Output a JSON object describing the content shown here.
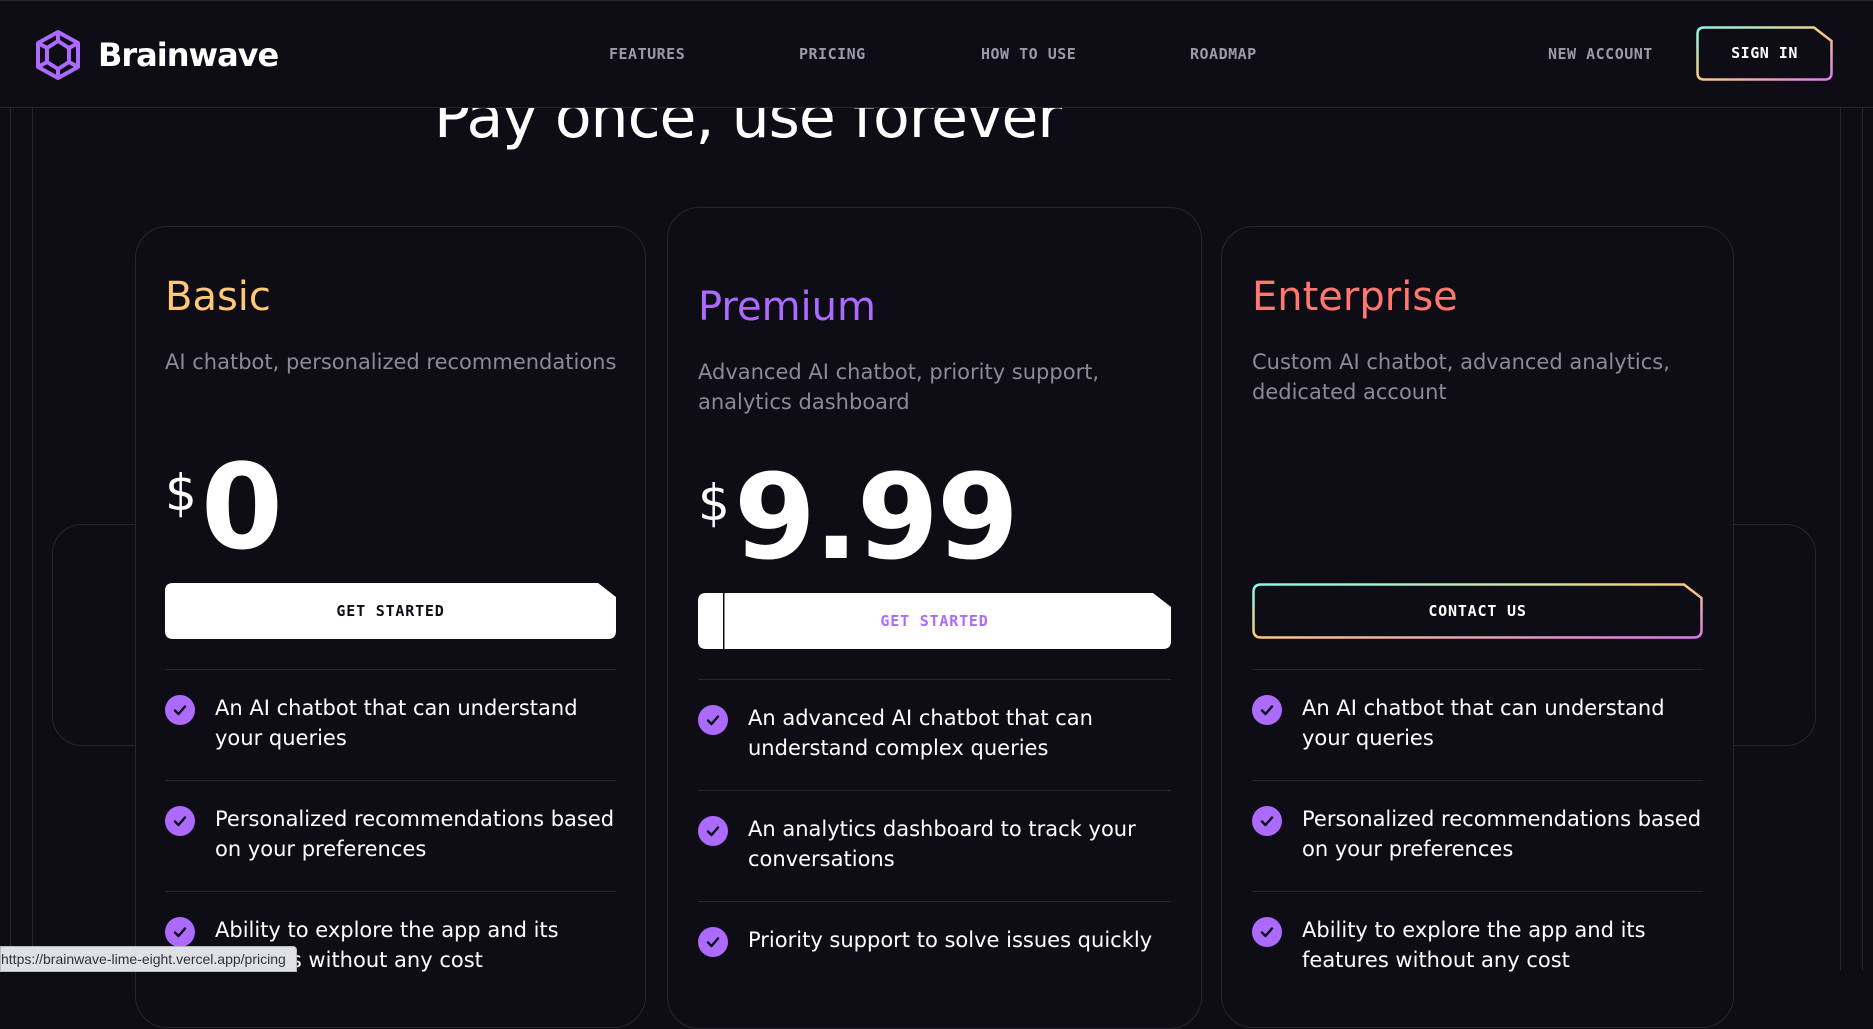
{
  "brand": {
    "name": "Brainwave"
  },
  "nav": {
    "items": [
      {
        "label": "FEATURES"
      },
      {
        "label": "PRICING"
      },
      {
        "label": "HOW TO USE"
      },
      {
        "label": "ROADMAP"
      }
    ],
    "new_account": "NEW ACCOUNT",
    "sign_in": "SIGN IN"
  },
  "hero": {
    "title": "Pay once, use forever"
  },
  "plans": [
    {
      "title": "Basic",
      "title_color": "#ffc876",
      "description": "AI chatbot, personalized recommendations",
      "currency": "$",
      "price": "0",
      "button": "GET STARTED",
      "features": [
        "An AI chatbot that can understand your queries",
        "Personalized recommendations based on your preferences",
        "Ability to explore the app and its features without any cost"
      ]
    },
    {
      "title": "Premium",
      "title_color": "#ac6aff",
      "description": "Advanced AI chatbot, priority support, analytics dashboard",
      "currency": "$",
      "price": "9.99",
      "button": "GET STARTED",
      "features": [
        "An advanced AI chatbot that can understand complex queries",
        "An analytics dashboard to track your conversations",
        "Priority support to solve issues quickly"
      ]
    },
    {
      "title": "Enterprise",
      "title_color": "#ff776f",
      "description": "Custom AI chatbot, advanced analytics, dedicated account",
      "button": "CONTACT US",
      "features": [
        "An AI chatbot that can understand your queries",
        "Personalized recommendations based on your preferences",
        "Ability to explore the app and its features without any cost"
      ]
    }
  ],
  "status_bar": {
    "url": "https://brainwave-lime-eight.vercel.app/pricing"
  },
  "colors": {
    "background": "#0e0c15",
    "accent": "#ac6aff",
    "border": "#26242e"
  }
}
